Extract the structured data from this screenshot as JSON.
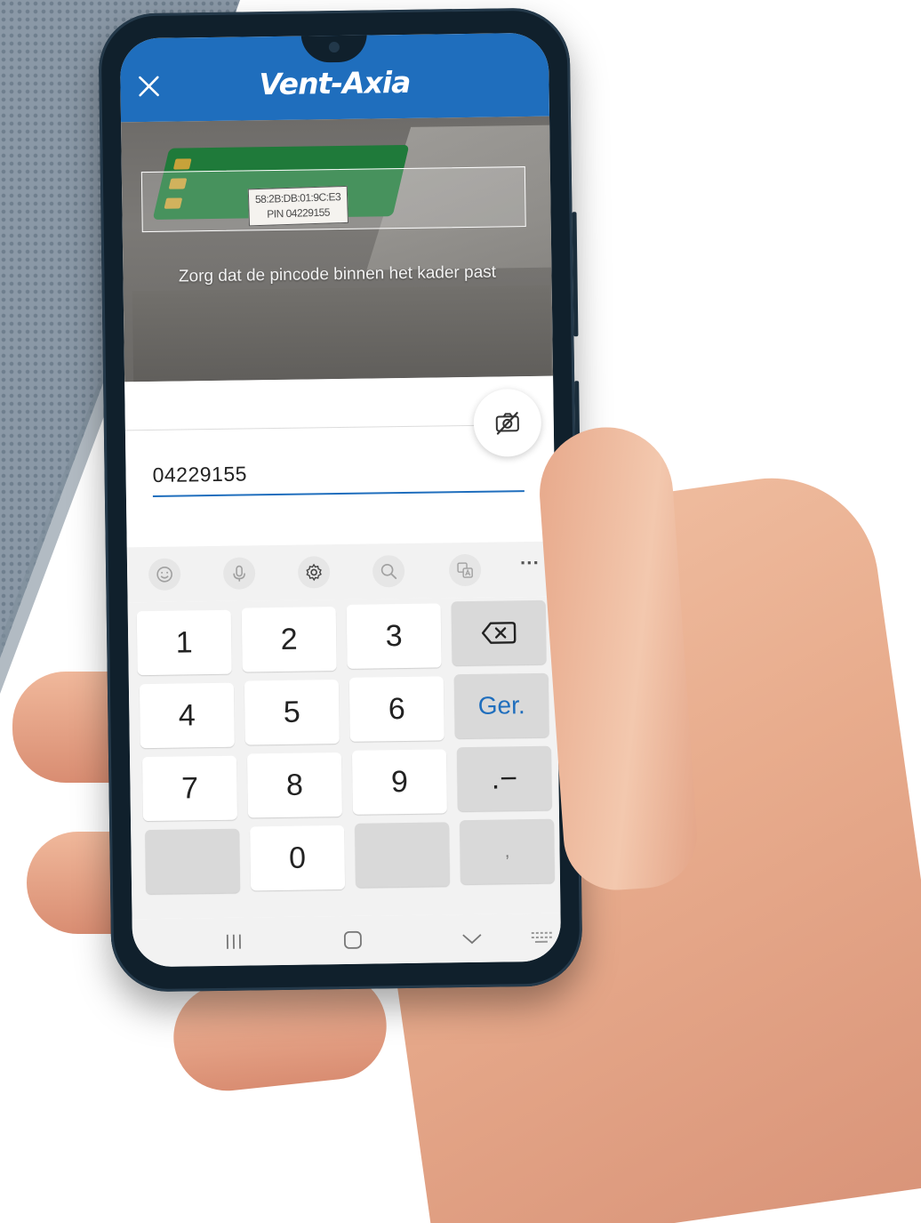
{
  "app": {
    "brand": "Vent-Axia",
    "header_color": "#1f6ebd"
  },
  "camera": {
    "hint": "Zorg dat de pincode binnen het kader past",
    "label_line1": "58:2B:DB:01:9C:E3",
    "label_line2": "PIN 04229155"
  },
  "form": {
    "pin_value": "04229155"
  },
  "keyboard": {
    "toolbar_icons": [
      "emoji-icon",
      "microphone-icon",
      "settings-icon",
      "search-icon",
      "translate-icon",
      "more-icon"
    ],
    "more_label": "···",
    "keys": {
      "k1": "1",
      "k2": "2",
      "k3": "3",
      "k4": "4",
      "k5": "5",
      "k6": "6",
      "k7": "7",
      "k8": "8",
      "k9": "9",
      "k0": "0",
      "done": "Ger.",
      "dot_dash": ".−",
      "comma": ","
    }
  },
  "navbar": {
    "icons": [
      "recent-apps-icon",
      "home-icon",
      "hide-keyboard-icon",
      "keyboard-icon"
    ]
  }
}
